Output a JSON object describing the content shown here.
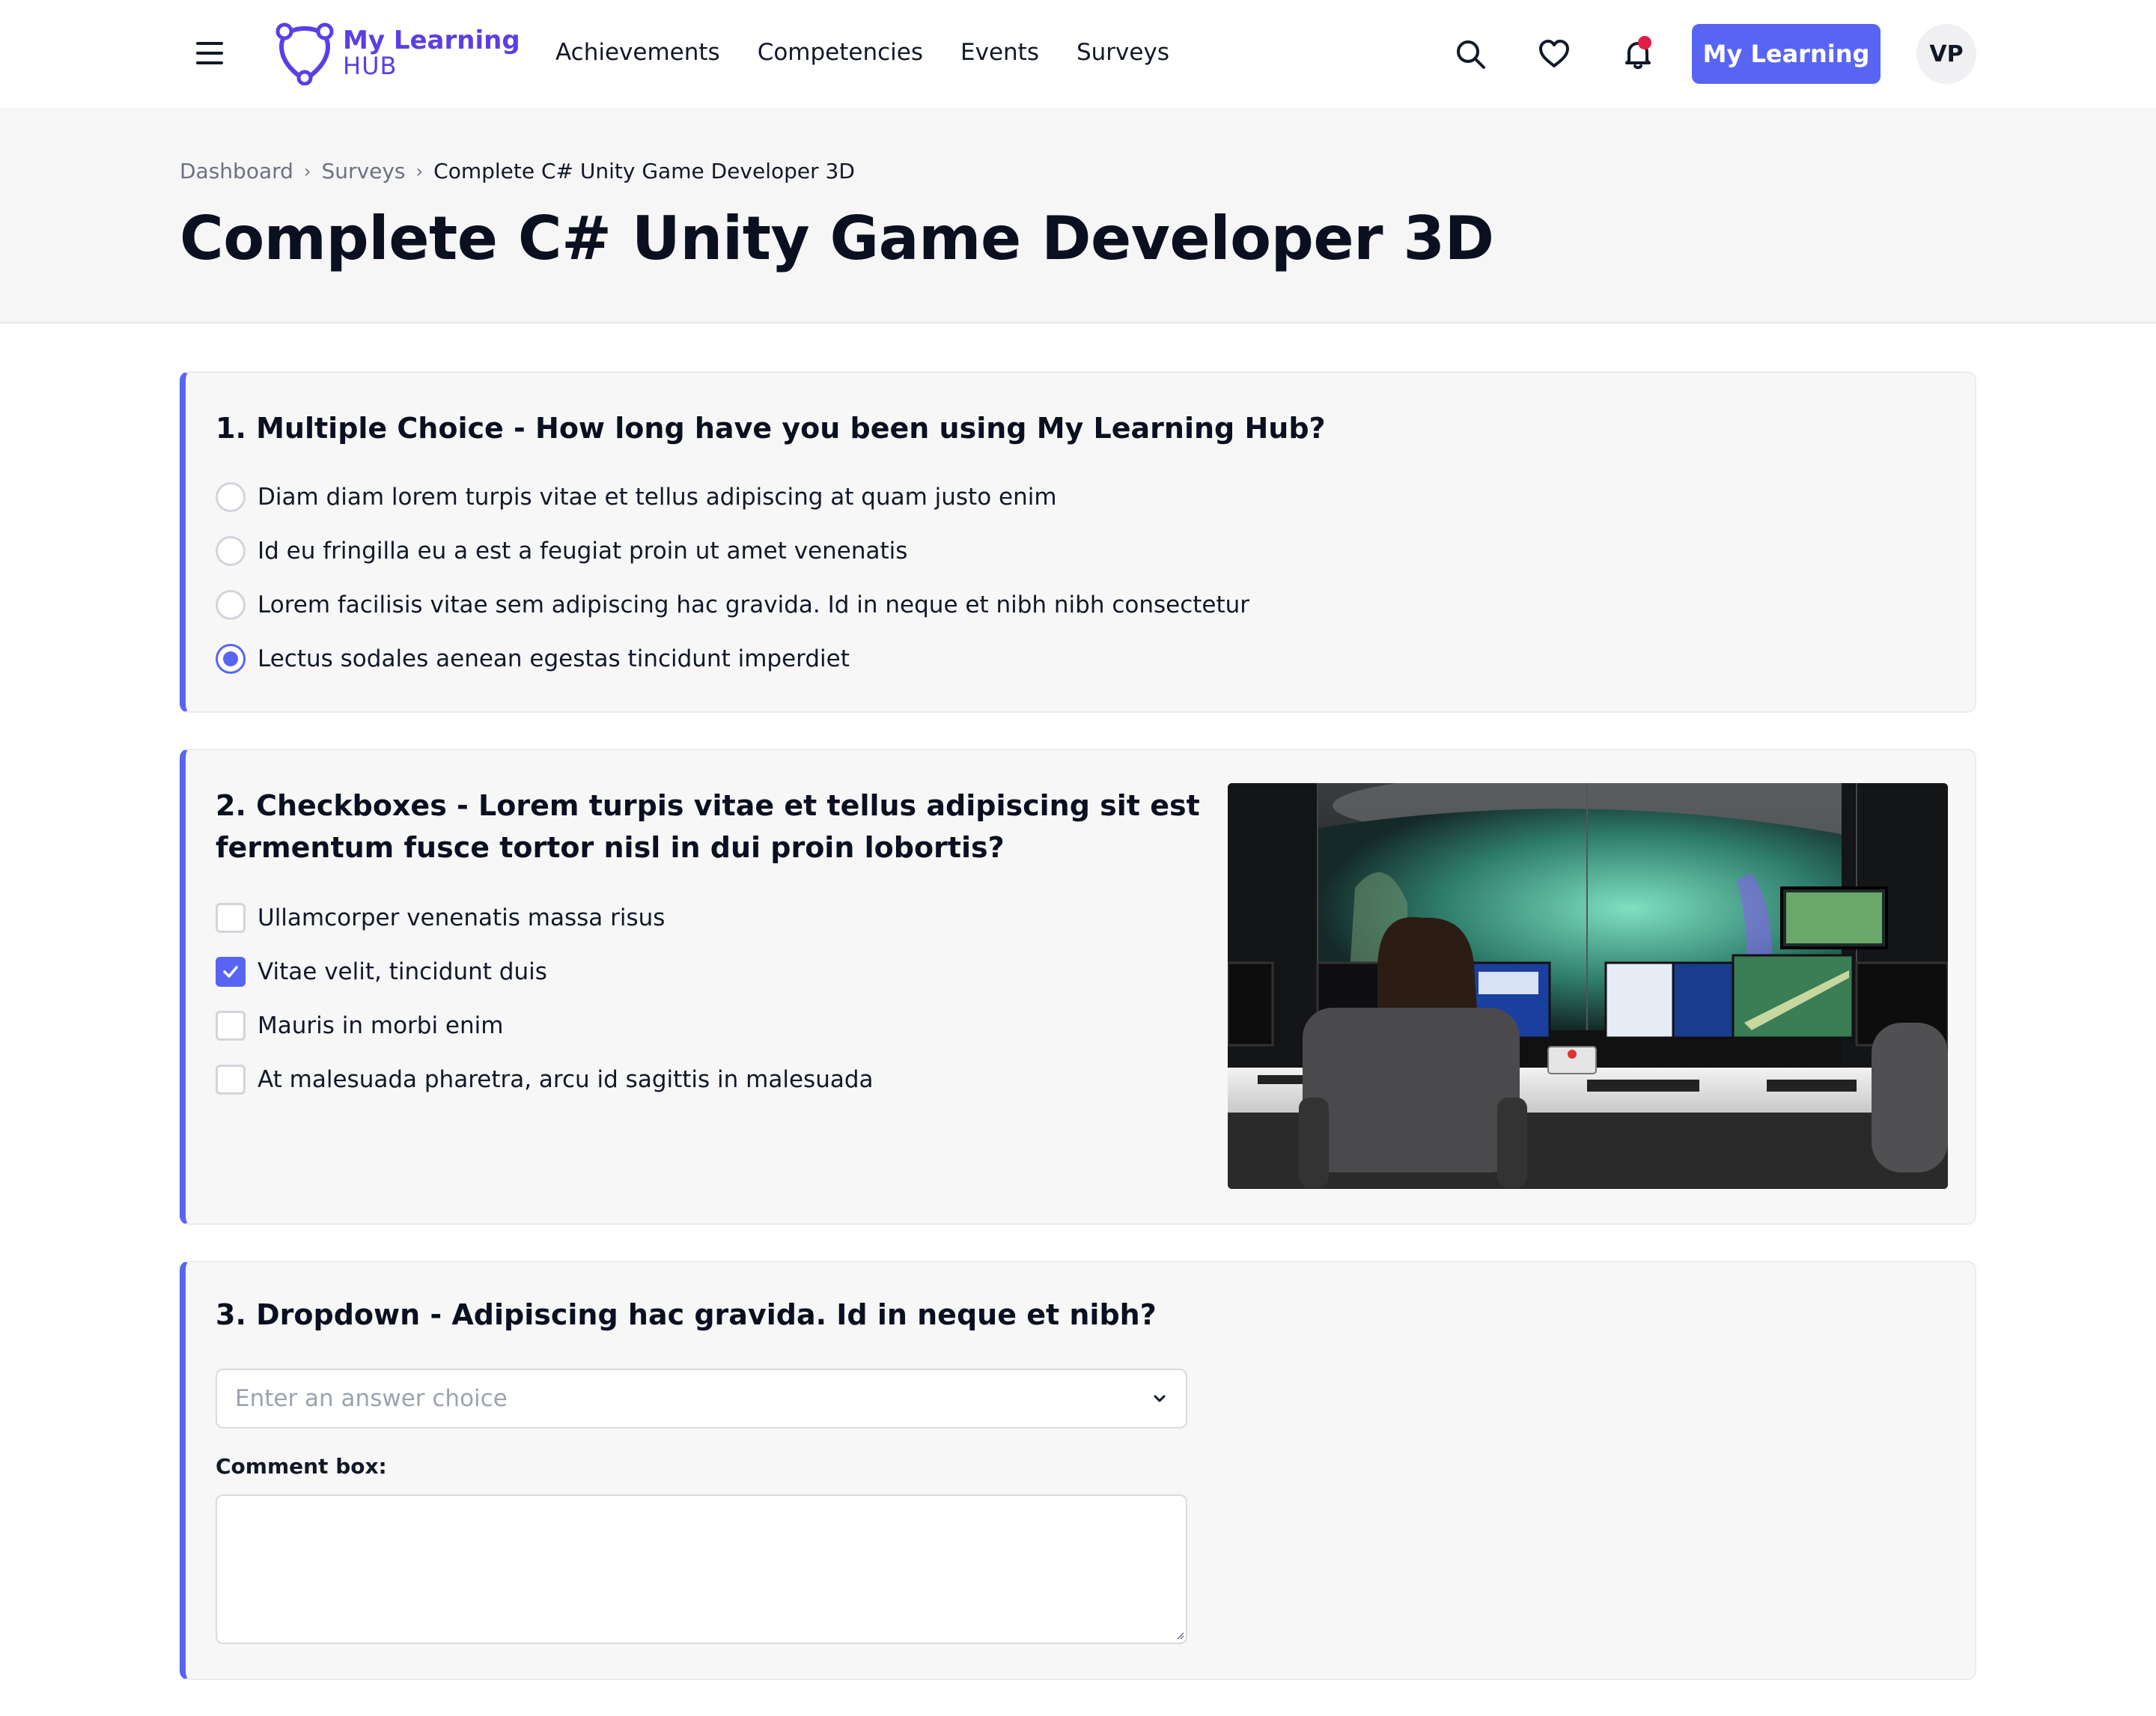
{
  "header": {
    "logo": {
      "line1": "My Learning",
      "line2": "HUB",
      "brand_color": "#5b3fe4"
    },
    "nav": [
      "Achievements",
      "Competencies",
      "Events",
      "Surveys"
    ],
    "icons": [
      "menu-icon",
      "search-icon",
      "heart-icon",
      "bell-icon"
    ],
    "cta_label": "My Learning",
    "cta_color": "#5865f2",
    "avatar_initials": "VP"
  },
  "breadcrumb": [
    "Dashboard",
    "Surveys",
    "Complete C# Unity Game Developer 3D"
  ],
  "page_title": "Complete C# Unity Game Developer 3D",
  "questions": [
    {
      "title": "1. Multiple Choice - How long have you been using My Learning Hub?",
      "type": "radio",
      "options": [
        "Diam diam lorem turpis vitae et tellus adipiscing at quam justo enim",
        "Id eu fringilla eu a est a feugiat proin ut amet venenatis",
        "Lorem facilisis vitae sem adipiscing hac gravida. Id in neque et nibh nibh consectetur",
        "Lectus sodales aenean egestas tincidunt imperdiet"
      ],
      "selected_index": 3
    },
    {
      "title_line1": "2. Checkboxes - Lorem turpis vitae et tellus adipiscing sit est",
      "title_line2": "fermentum fusce tortor nisl in dui proin lobortis?",
      "type": "checkbox",
      "options": [
        "Ullamcorper venenatis massa risus",
        "Vitae velit, tincidunt duis",
        "Mauris in morbi enim",
        "At malesuada pharetra, arcu id sagittis in malesuada"
      ],
      "checked": [
        false,
        true,
        false,
        false
      ]
    },
    {
      "title": "3. Dropdown - Adipiscing hac gravida. Id in neque et nibh?",
      "type": "dropdown",
      "placeholder": "Enter an answer choice",
      "comment_label": "Comment box:"
    }
  ]
}
